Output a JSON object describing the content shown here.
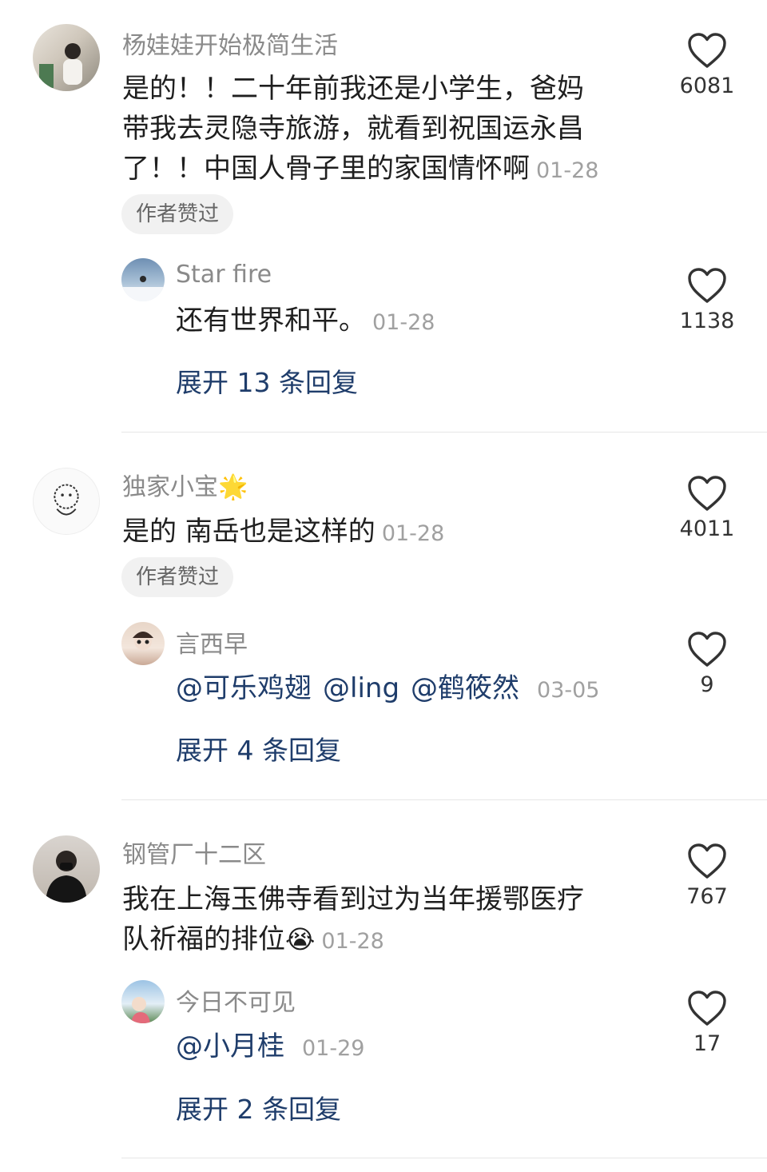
{
  "comments": [
    {
      "user": "杨娃娃开始极简生活",
      "text_lines": [
        "是的！！二十年前我还是小学生，爸妈",
        "带我去灵隐寺旅游，就看到祝国运永昌",
        "了！！中国人骨子里的家国情怀啊"
      ],
      "date": "01-28",
      "likes": "6081",
      "author_liked": "作者赞过",
      "reply": {
        "user": "Star fire",
        "text": "还有世界和平。",
        "date": "01-28",
        "likes": "1138"
      },
      "expand": "展开 13 条回复"
    },
    {
      "user": "独家小宝🌟",
      "text_lines": [
        "是的 南岳也是这样的"
      ],
      "date": "01-28",
      "likes": "4011",
      "author_liked": "作者赞过",
      "reply": {
        "user": "言西早",
        "mentions": [
          "@可乐鸡翅",
          "@ling",
          "@鹤筱然"
        ],
        "date": "03-05",
        "likes": "9"
      },
      "expand": "展开 4 条回复"
    },
    {
      "user": "钢管厂十二区",
      "text_lines": [
        "我在上海玉佛寺看到过为当年援鄂医疗",
        "队祈福的排位"
      ],
      "emoji": "😭",
      "date": "01-28",
      "likes": "767",
      "reply": {
        "user": "今日不可见",
        "mentions": [
          "@小月桂"
        ],
        "date": "01-29",
        "likes": "17"
      },
      "expand": "展开 2 条回复"
    }
  ],
  "colors": {
    "link": "#1f3d6b",
    "meta": "#8a8a8a",
    "chip_bg": "#f1f1f1"
  },
  "icons": {
    "like": "heart-outline-icon"
  }
}
